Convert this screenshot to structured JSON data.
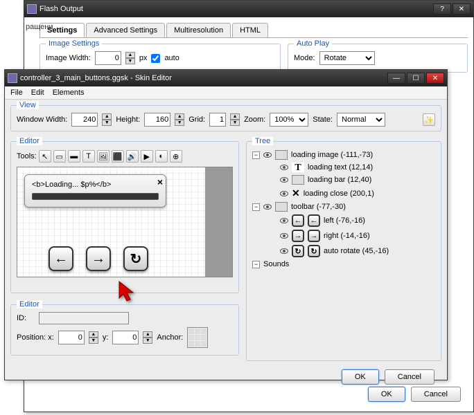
{
  "win1": {
    "title": "Flash Output",
    "tabs": [
      "Settings",
      "Advanced Settings",
      "Multiresolution",
      "HTML"
    ],
    "image_settings": {
      "legend": "Image Settings",
      "width_label": "Image Width:",
      "width_value": "0",
      "px": "px",
      "auto": "auto"
    },
    "auto_play": {
      "legend": "Auto Play",
      "mode_label": "Mode:",
      "mode_value": "Rotate"
    },
    "fragment": "ращени",
    "ok": "OK",
    "cancel": "Cancel"
  },
  "win2": {
    "title": "controller_3_main_buttons.ggsk - Skin Editor",
    "menu": [
      "File",
      "Edit",
      "Elements"
    ],
    "view": {
      "legend": "View",
      "ww_label": "Window Width:",
      "ww_value": "240",
      "h_label": "Height:",
      "h_value": "160",
      "grid_label": "Grid:",
      "grid_value": "1",
      "zoom_label": "Zoom:",
      "zoom_value": "100%",
      "state_label": "State:",
      "state_value": "Normal"
    },
    "editor": {
      "legend": "Editor",
      "tools_label": "Tools:",
      "loading_text": "<b>Loading... $p%</b>",
      "props_legend": "Editor",
      "id_label": "ID:",
      "id_value": "",
      "pos_label": "Position: x:",
      "x_value": "0",
      "y_label": "y:",
      "y_value": "0",
      "anchor_label": "Anchor:"
    },
    "tree": {
      "legend": "Tree",
      "nodes": {
        "loading_image": "loading image (-111,-73)",
        "loading_text": "loading text (12,14)",
        "loading_bar": "loading bar (12,40)",
        "loading_close": "loading close (200,1)",
        "toolbar": "toolbar (-77,-30)",
        "left": "left (-76,-16)",
        "right": "right (-14,-16)",
        "auto_rotate": "auto rotate (45,-16)",
        "sounds": "Sounds"
      }
    },
    "ok": "OK",
    "cancel": "Cancel"
  }
}
